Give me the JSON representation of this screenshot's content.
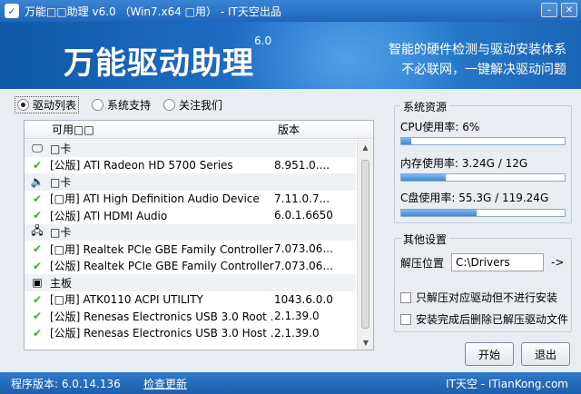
{
  "window": {
    "title": "万能□□助理 v6.0 （Win7.x64 □用） - IT天空出品"
  },
  "banner": {
    "title": "万能驱动助理",
    "version": "6.0",
    "slogan_line1": "智能的硬件检测与驱动安装体系",
    "slogan_line2": "不必联网，一键解决驱动问题"
  },
  "tabs": [
    {
      "label": "驱动列表",
      "selected": true
    },
    {
      "label": "系统支持",
      "selected": false
    },
    {
      "label": "关注我们",
      "selected": false
    }
  ],
  "driver_list": {
    "col_name": "可用□□",
    "col_version": "版本",
    "rows": [
      {
        "type": "category",
        "icon": "display-icon",
        "name": "□卡"
      },
      {
        "type": "driver",
        "name": "[公版] ATI Radeon HD 5700 Series",
        "version": "8.951.0...."
      },
      {
        "type": "category",
        "icon": "speaker-icon",
        "name": "□卡"
      },
      {
        "type": "driver",
        "name": "[□用] ATI High Definition Audio Device",
        "version": "7.11.0.7..."
      },
      {
        "type": "driver",
        "name": "[公版] ATI HDMI Audio",
        "version": "6.0.1.6650"
      },
      {
        "type": "category",
        "icon": "network-icon",
        "name": "□卡"
      },
      {
        "type": "driver",
        "name": "[□用] Realtek PCIe GBE Family Controller",
        "version": "7.073.06..."
      },
      {
        "type": "driver",
        "name": "[公版] Realtek PCIe GBE Family Controller",
        "version": "7.073.06..."
      },
      {
        "type": "category",
        "icon": "motherboard-icon",
        "name": "主板"
      },
      {
        "type": "driver",
        "name": "[□用] ATK0110 ACPI UTILITY",
        "version": "1043.6.0.0"
      },
      {
        "type": "driver",
        "name": "[公版] Renesas Electronics USB 3.0 Root ...",
        "version": "2.1.39.0"
      },
      {
        "type": "driver",
        "name": "[公版] Renesas Electronics USB 3.0 Host ...",
        "version": "2.1.39.0"
      }
    ]
  },
  "resources": {
    "title": "系统资源",
    "cpu_label": "CPU使用率:",
    "cpu_value": "6%",
    "cpu_fraction": 0.06,
    "mem_label": "内存使用率:",
    "mem_value": "3.24G / 12G",
    "mem_fraction": 0.27,
    "disk_label": "C盘使用率:",
    "disk_value": "55.3G / 119.24G",
    "disk_fraction": 0.46
  },
  "settings": {
    "title": "其他设置",
    "extract_label": "解压位置",
    "extract_path": "C:\\Drivers",
    "browse": "->",
    "opt1": "只解压对应驱动但不进行安装",
    "opt2": "安装完成后删除已解压驱动文件"
  },
  "buttons": {
    "start": "开始",
    "exit": "退出"
  },
  "status": {
    "version": "程序版本: 6.0.14.136",
    "update": "检查更新",
    "brand": "IT天空 - ITianKong.com"
  },
  "colors": {
    "accent": "#1f66bb",
    "check": "#3fae2a"
  }
}
